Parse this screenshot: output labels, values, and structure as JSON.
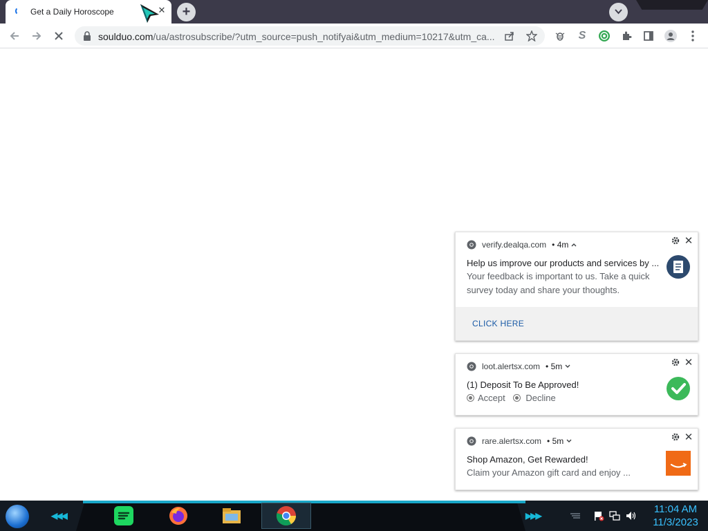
{
  "browser": {
    "tab": {
      "title": "Get a Daily Horoscope",
      "close_glyph": "✕"
    },
    "new_tab_glyph": "+",
    "address": {
      "domain": "soulduo.com",
      "path": "/ua/astrosubscribe/?utm_source=push_notifyai&utm_medium=10217&utm_ca..."
    },
    "toolbar_icons": [
      "back-icon",
      "forward-icon",
      "stop-icon",
      "lock-icon",
      "share-icon",
      "star-icon",
      "extension-bee-icon",
      "extension-s-icon",
      "extension-globe-icon",
      "puzzle-icon",
      "sidepanel-icon",
      "profile-icon",
      "menu-icon"
    ]
  },
  "notifications": [
    {
      "origin": "verify.dealqa.com",
      "time": "• 4m",
      "title": "Help us improve our products and services by ...",
      "body_lines": [
        "Your feedback is important to us. Take a quick",
        "survey today and share your thoughts."
      ],
      "action": "CLICK HERE",
      "icon": "survey-document-icon"
    },
    {
      "origin": "loot.alertsx.com",
      "time": "• 5m",
      "title": "(1) Deposit To Be Approved!",
      "options": [
        "Accept",
        "Decline"
      ],
      "icon": "green-checkmark-icon"
    },
    {
      "origin": "rare.alertsx.com",
      "time": "• 5m",
      "title": "Shop Amazon, Get Rewarded!",
      "body": "Claim your Amazon gift card and enjoy ...",
      "icon": "amazon-icon"
    }
  ],
  "taskbar": {
    "clock": {
      "time": "11:04 AM",
      "date": "11/3/2023"
    },
    "apps": [
      "spotify-icon",
      "firefox-icon",
      "file-explorer-icon",
      "chrome-icon"
    ]
  },
  "colors": {
    "accent": "#1a73e8",
    "taskbar_accent": "#19a7c8",
    "clock": "#39c1ff",
    "check_green": "#3cb95a",
    "amazon_orange": "#f06a16"
  }
}
